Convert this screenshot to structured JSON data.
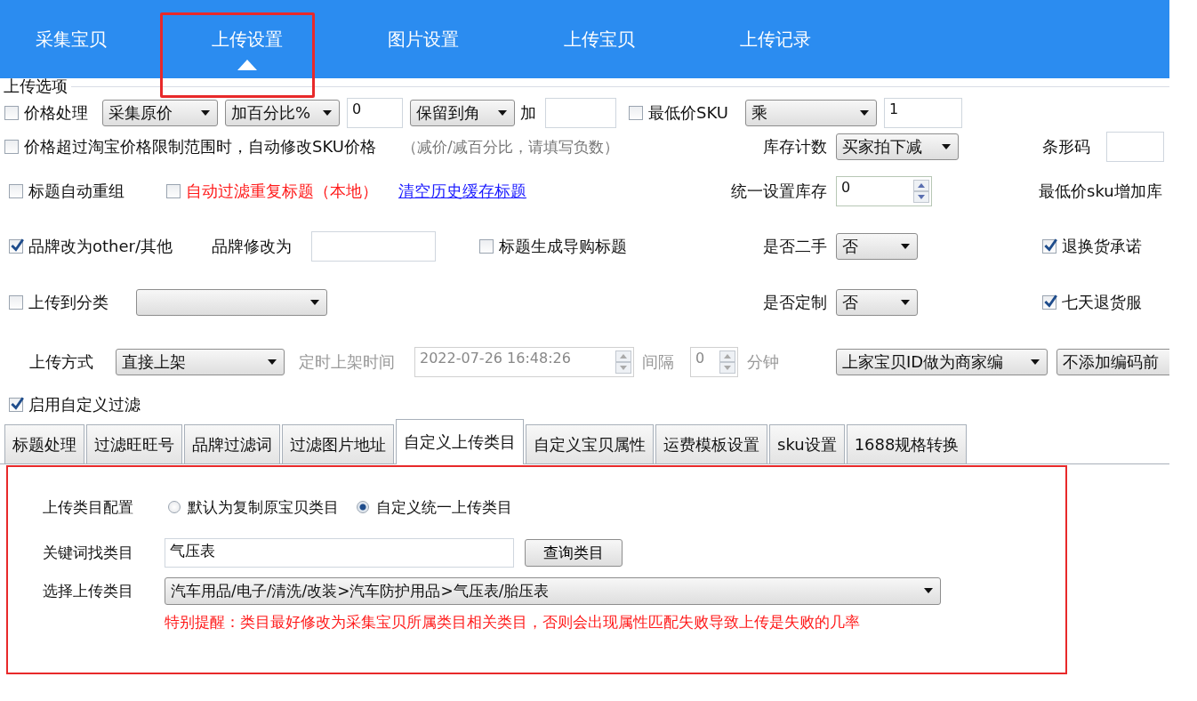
{
  "nav_tabs": [
    {
      "label": "采集宝贝",
      "selected": false
    },
    {
      "label": "上传设置",
      "selected": true
    },
    {
      "label": "图片设置",
      "selected": false
    },
    {
      "label": "上传宝贝",
      "selected": false
    },
    {
      "label": "上传记录",
      "selected": false
    }
  ],
  "options": {
    "title": "上传选项",
    "rows": [
      {
        "items": [
          {
            "kind": "checkbox",
            "label": "价格处理",
            "checked": false
          },
          {
            "kind": "select",
            "value": "采集原价"
          },
          {
            "kind": "select",
            "value": "加百分比%"
          },
          {
            "kind": "input",
            "value": "0"
          },
          {
            "kind": "select",
            "value": "保留到角"
          },
          {
            "kind": "label",
            "text": "加"
          },
          {
            "kind": "input"
          },
          {
            "kind": "checkbox",
            "label": "最低价SKU",
            "checked": false
          },
          {
            "kind": "select",
            "value": "乘"
          },
          {
            "kind": "input",
            "value": "1"
          }
        ]
      },
      {
        "left": [
          {
            "kind": "checkbox",
            "label": "价格超过淘宝价格限制范围时，自动修改SKU价格",
            "checked": false
          },
          {
            "kind": "hint",
            "text": "（减价/减百分比，请填写负数）"
          }
        ],
        "middle": [
          {
            "kind": "label",
            "text": "库存计数"
          },
          {
            "kind": "select",
            "value": "买家拍下减"
          }
        ],
        "right": [
          {
            "kind": "label",
            "text": "条形码"
          },
          {
            "kind": "input"
          }
        ]
      },
      {
        "left": [
          {
            "kind": "checkbox",
            "label": "标题自动重组",
            "checked": false
          },
          {
            "kind": "checkbox",
            "label": "自动过滤重复标题（本地）",
            "checked": false,
            "alert": true
          },
          {
            "kind": "link",
            "text": "清空历史缓存标题"
          }
        ],
        "middle": [
          {
            "kind": "label",
            "text": "统一设置库存"
          },
          {
            "kind": "spinner",
            "value": "0"
          }
        ],
        "right": [
          {
            "kind": "label",
            "text": "最低价sku增加库"
          }
        ]
      },
      {
        "left": [
          {
            "kind": "checkbox",
            "label": "品牌改为other/其他",
            "checked": true
          },
          {
            "kind": "label",
            "text": "品牌修改为"
          },
          {
            "kind": "input"
          },
          {
            "kind": "checkbox",
            "label": "标题生成导购标题",
            "checked": false
          }
        ],
        "middle": [
          {
            "kind": "label",
            "text": "是否二手"
          },
          {
            "kind": "select",
            "value": "否"
          }
        ],
        "right": [
          {
            "kind": "checkbox",
            "label": "退换货承诺",
            "checked": true
          }
        ]
      },
      {
        "left": [
          {
            "kind": "checkbox",
            "label": "上传到分类",
            "checked": false
          },
          {
            "kind": "select"
          }
        ],
        "middle": [
          {
            "kind": "label",
            "text": "是否定制"
          },
          {
            "kind": "select",
            "value": "否"
          }
        ],
        "right": [
          {
            "kind": "checkbox",
            "label": "七天退货服",
            "checked": true
          }
        ]
      },
      {
        "items": [
          {
            "kind": "label",
            "text": "上传方式",
            "disabled": false
          },
          {
            "kind": "select",
            "value": "直接上架"
          },
          {
            "kind": "label",
            "text": "定时上架时间",
            "disabled": true
          },
          {
            "kind": "spinner",
            "value": "2022-07-26 16:48:26",
            "disabled": true
          },
          {
            "kind": "label",
            "text": "间隔",
            "disabled": true
          },
          {
            "kind": "spinner",
            "value": "0",
            "disabled": true
          },
          {
            "kind": "label",
            "text": "分钟",
            "disabled": true
          },
          {
            "kind": "select",
            "value": "上家宝贝ID做为商家编"
          },
          {
            "kind": "select",
            "value": "不添加编码前",
            "arrow_visible": false
          }
        ]
      },
      {
        "items": [
          {
            "kind": "checkbox",
            "label": "启用自定义过滤",
            "checked": true
          }
        ]
      }
    ]
  },
  "sub_tabs": [
    {
      "label": "标题处理",
      "selected": false
    },
    {
      "label": "过滤旺旺号",
      "selected": false
    },
    {
      "label": "品牌过滤词",
      "selected": false
    },
    {
      "label": "过滤图片地址",
      "selected": false
    },
    {
      "label": "自定义上传类目",
      "selected": true
    },
    {
      "label": "自定义宝贝属性",
      "selected": false
    },
    {
      "label": "运费模板设置",
      "selected": false
    },
    {
      "label": "sku设置",
      "selected": false
    },
    {
      "label": "1688规格转换",
      "selected": false
    }
  ],
  "panel": {
    "category_config": {
      "label": "上传类目配置",
      "options": [
        {
          "label": "默认为复制原宝贝类目",
          "selected": false
        },
        {
          "label": "自定义统一上传类目",
          "selected": true
        }
      ]
    },
    "keyword": {
      "label": "关键词找类目",
      "value": "气压表",
      "button": "查询类目"
    },
    "category": {
      "label": "选择上传类目",
      "value": "汽车用品/电子/清洗/改装>汽车防护用品>气压表/胎压表"
    },
    "warning": "特别提醒：类目最好修改为采集宝贝所属类目相关类目，否则会出现属性匹配失败导致上传是失败的几率"
  }
}
